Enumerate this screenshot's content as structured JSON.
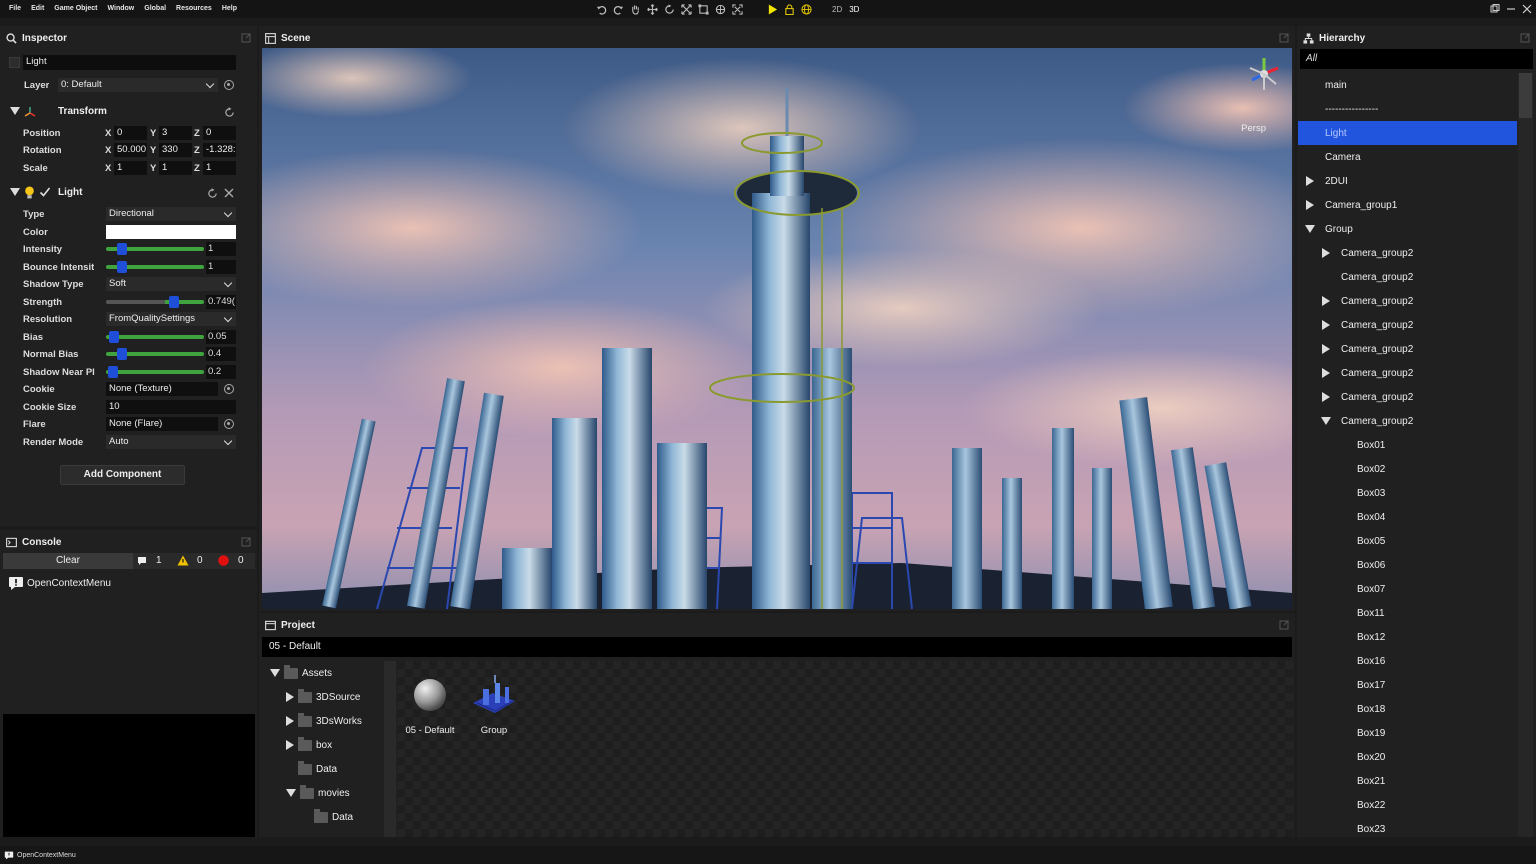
{
  "menu": [
    "File",
    "Edit",
    "Game Object",
    "Window",
    "Global",
    "Resources",
    "Help"
  ],
  "toolbar": {
    "mode_2d": "2D",
    "mode_3d": "3D"
  },
  "inspector": {
    "title": "Inspector",
    "object_name": "Light",
    "layer_label": "Layer",
    "layer_value": "0: Default",
    "transform": {
      "title": "Transform",
      "position_label": "Position",
      "position": {
        "x": "0",
        "y": "3",
        "z": "0"
      },
      "rotation_label": "Rotation",
      "rotation": {
        "x": "50.000",
        "y": "330",
        "z": "-1.328:"
      },
      "scale_label": "Scale",
      "scale": {
        "x": "1",
        "y": "1",
        "z": "1"
      }
    },
    "light": {
      "title": "Light",
      "type_label": "Type",
      "type_value": "Directional",
      "color_label": "Color",
      "color_value": "#ffffff",
      "intensity_label": "Intensity",
      "intensity_value": "1",
      "intensity_fraction": 0.125,
      "bounce_label": "Bounce Intensit",
      "bounce_value": "1",
      "bounce_fraction": 0.125,
      "shadow_type_label": "Shadow Type",
      "shadow_type_value": "Soft",
      "strength_label": "Strength",
      "strength_value": "0.749(",
      "strength_fraction": 0.72,
      "resolution_label": "Resolution",
      "resolution_value": "FromQualitySettings",
      "bias_label": "Bias",
      "bias_value": "0.05",
      "bias_fraction": 0.03,
      "normal_bias_label": "Normal Bias",
      "normal_bias_value": "0.4",
      "normal_bias_fraction": 0.13,
      "near_plane_label": "Shadow Near Pl",
      "near_plane_value": "0.2",
      "near_plane_fraction": 0.02,
      "cookie_label": "Cookie",
      "cookie_value": "None (Texture)",
      "cookie_size_label": "Cookie Size",
      "cookie_size_value": "10",
      "flare_label": "Flare",
      "flare_value": "None (Flare)",
      "render_mode_label": "Render Mode",
      "render_mode_value": "Auto"
    },
    "add_component": "Add Component"
  },
  "console": {
    "title": "Console",
    "clear": "Clear",
    "info_count": "1",
    "warn_count": "0",
    "error_count": "0",
    "message": "OpenContextMenu"
  },
  "scene": {
    "title": "Scene",
    "projection": "Persp"
  },
  "project": {
    "title": "Project",
    "path": "05 - Default",
    "tree": [
      {
        "label": "Assets",
        "level": 0,
        "state": "open"
      },
      {
        "label": "3DSource",
        "level": 1,
        "state": "closed"
      },
      {
        "label": "3DsWorks",
        "level": 1,
        "state": "closed"
      },
      {
        "label": "box",
        "level": 1,
        "state": "closed"
      },
      {
        "label": "Data",
        "level": 1,
        "state": "none"
      },
      {
        "label": "movies",
        "level": 1,
        "state": "open"
      },
      {
        "label": "Data",
        "level": 2,
        "state": "none"
      }
    ],
    "assets": [
      {
        "label": "05 - Default",
        "icon": "sphere-material-icon"
      },
      {
        "label": "Group",
        "icon": "model-prefab-icon"
      }
    ]
  },
  "hierarchy": {
    "title": "Hierarchy",
    "filter": "All",
    "items": [
      {
        "label": "main",
        "level": 0,
        "state": "none"
      },
      {
        "label": "----------------",
        "level": 0,
        "state": "none"
      },
      {
        "label": "Light",
        "level": 0,
        "state": "none",
        "selected": true
      },
      {
        "label": "Camera",
        "level": 0,
        "state": "none"
      },
      {
        "label": "2DUI",
        "level": 0,
        "state": "closed"
      },
      {
        "label": "Camera_group1",
        "level": 0,
        "state": "closed"
      },
      {
        "label": "Group",
        "level": 0,
        "state": "open"
      },
      {
        "label": "Camera_group2",
        "level": 1,
        "state": "closed"
      },
      {
        "label": "Camera_group2",
        "level": 1,
        "state": "none"
      },
      {
        "label": "Camera_group2",
        "level": 1,
        "state": "closed"
      },
      {
        "label": "Camera_group2",
        "level": 1,
        "state": "closed"
      },
      {
        "label": "Camera_group2",
        "level": 1,
        "state": "closed"
      },
      {
        "label": "Camera_group2",
        "level": 1,
        "state": "closed"
      },
      {
        "label": "Camera_group2",
        "level": 1,
        "state": "closed"
      },
      {
        "label": "Camera_group2",
        "level": 1,
        "state": "open"
      },
      {
        "label": "Box01",
        "level": 2,
        "state": "none"
      },
      {
        "label": "Box02",
        "level": 2,
        "state": "none"
      },
      {
        "label": "Box03",
        "level": 2,
        "state": "none"
      },
      {
        "label": "Box04",
        "level": 2,
        "state": "none"
      },
      {
        "label": "Box05",
        "level": 2,
        "state": "none"
      },
      {
        "label": "Box06",
        "level": 2,
        "state": "none"
      },
      {
        "label": "Box07",
        "level": 2,
        "state": "none"
      },
      {
        "label": "Box11",
        "level": 2,
        "state": "none"
      },
      {
        "label": "Box12",
        "level": 2,
        "state": "none"
      },
      {
        "label": "Box16",
        "level": 2,
        "state": "none"
      },
      {
        "label": "Box17",
        "level": 2,
        "state": "none"
      },
      {
        "label": "Box18",
        "level": 2,
        "state": "none"
      },
      {
        "label": "Box19",
        "level": 2,
        "state": "none"
      },
      {
        "label": "Box20",
        "level": 2,
        "state": "none"
      },
      {
        "label": "Box21",
        "level": 2,
        "state": "none"
      },
      {
        "label": "Box22",
        "level": 2,
        "state": "none"
      },
      {
        "label": "Box23",
        "level": 2,
        "state": "none"
      }
    ]
  },
  "status": {
    "message": "OpenContextMenu"
  },
  "colors": {
    "selection": "#2255dd",
    "slider_track": "#3fa33f",
    "slider_knob": "#1f4fd8",
    "play": "#f2e600"
  }
}
